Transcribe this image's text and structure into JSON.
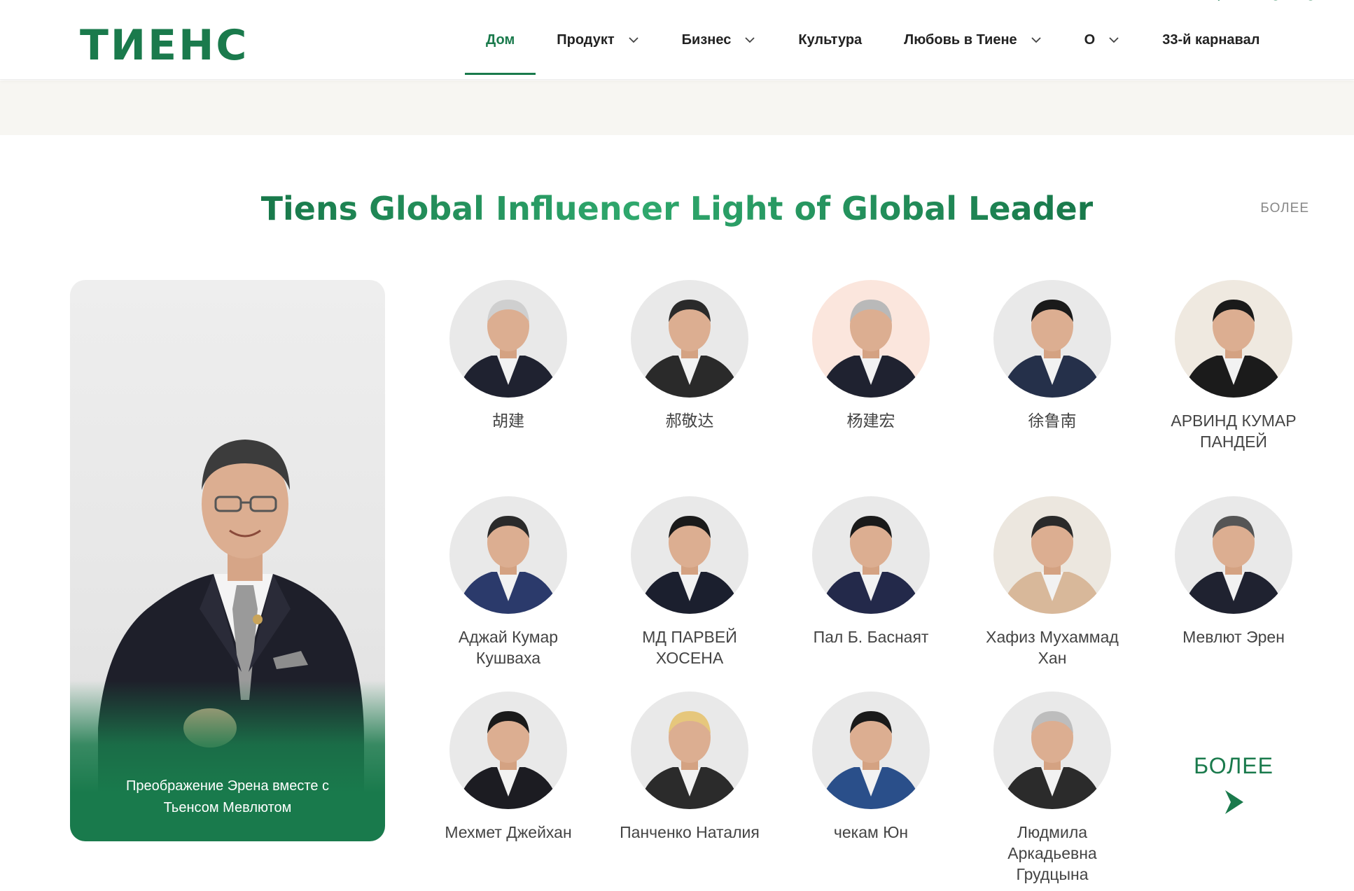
{
  "brand": {
    "logo_text": "ТИЕНС",
    "accent": "#1a7a4c"
  },
  "nav": {
    "items": [
      {
        "label": "Дом",
        "has_dropdown": false,
        "active": true
      },
      {
        "label": "Продукт",
        "has_dropdown": true
      },
      {
        "label": "Бизнес",
        "has_dropdown": true
      },
      {
        "label": "Культура",
        "has_dropdown": false
      },
      {
        "label": "Любовь в Тиене",
        "has_dropdown": true
      },
      {
        "label": "О",
        "has_dropdown": true
      },
      {
        "label": "33-й карнавал",
        "has_dropdown": false
      }
    ]
  },
  "section": {
    "title": "Tiens Global Influencer Light of Global Leader",
    "more_label": "БОЛЕЕ"
  },
  "featured": {
    "caption": "Преображение Эрена вместе с Тьенсом Мевлютом"
  },
  "leaders": [
    {
      "name": "胡建"
    },
    {
      "name": "郝敬达"
    },
    {
      "name": "杨建宏"
    },
    {
      "name": "徐鲁南"
    },
    {
      "name": "АРВИНД КУМАР ПАНДЕЙ"
    },
    {
      "name": "Аджай Кумар Кушваха"
    },
    {
      "name": "МД ПАРВЕЙ ХОСЕНА"
    },
    {
      "name": "Пал Б. Баснаят"
    },
    {
      "name": "Хафиз Мухаммад Хан"
    },
    {
      "name": "Мевлют Эрен"
    },
    {
      "name": "Мехмет Джейхан"
    },
    {
      "name": "Панченко Наталия"
    },
    {
      "name": "чекам Юн"
    },
    {
      "name": "Людмила Аркадьевна Грудцына"
    }
  ],
  "more_cell": {
    "label": "БОЛЕЕ",
    "icon": "chevron-right-icon"
  }
}
